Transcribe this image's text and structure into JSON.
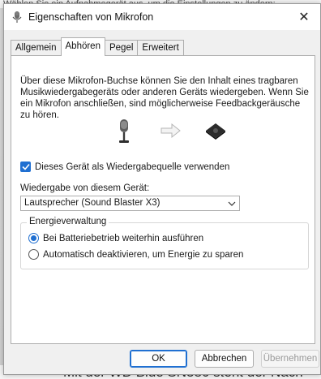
{
  "background": {
    "top_text": "Wählen Sie ein Aufnahmegerät aus, um die Einstellungen zu ändern:",
    "bottom_text": "Mit der WD Blue SN580 steht der Nach"
  },
  "window": {
    "title": "Eigenschaften von Mikrofon",
    "close_glyph": "✕"
  },
  "tabs": [
    {
      "label": "Allgemein"
    },
    {
      "label": "Abhören"
    },
    {
      "label": "Pegel"
    },
    {
      "label": "Erweitert"
    }
  ],
  "active_tab": "Abhören",
  "panel": {
    "description": "Über diese Mikrofon-Buchse können Sie den Inhalt eines tragbaren Musikwiedergabegeräts oder anderen Geräts wiedergeben. Wenn Sie ein Mikrofon anschließen, sind möglicherweise Feedbackgeräusche zu hören.",
    "listen_checkbox_label": "Dieses Gerät als Wiedergabequelle verwenden",
    "listen_checked": true,
    "playback_label": "Wiedergabe von diesem Gerät:",
    "playback_device": "Lautsprecher (Sound Blaster X3)",
    "power_group_title": "Energieverwaltung",
    "power_options": [
      {
        "label": "Bei Batteriebetrieb weiterhin ausführen",
        "selected": true
      },
      {
        "label": "Automatisch deaktivieren, um Energie zu sparen",
        "selected": false
      }
    ]
  },
  "footer": {
    "ok_label": "OK",
    "cancel_label": "Abbrechen",
    "apply_label": "Übernehmen",
    "apply_enabled": false
  },
  "colors": {
    "accent": "#1f6fd1"
  },
  "icons": {
    "title": "microphone-icon",
    "illustration_source": "microphone-icon",
    "illustration_arrow": "arrow-right-icon",
    "illustration_target": "sound-device-icon"
  }
}
